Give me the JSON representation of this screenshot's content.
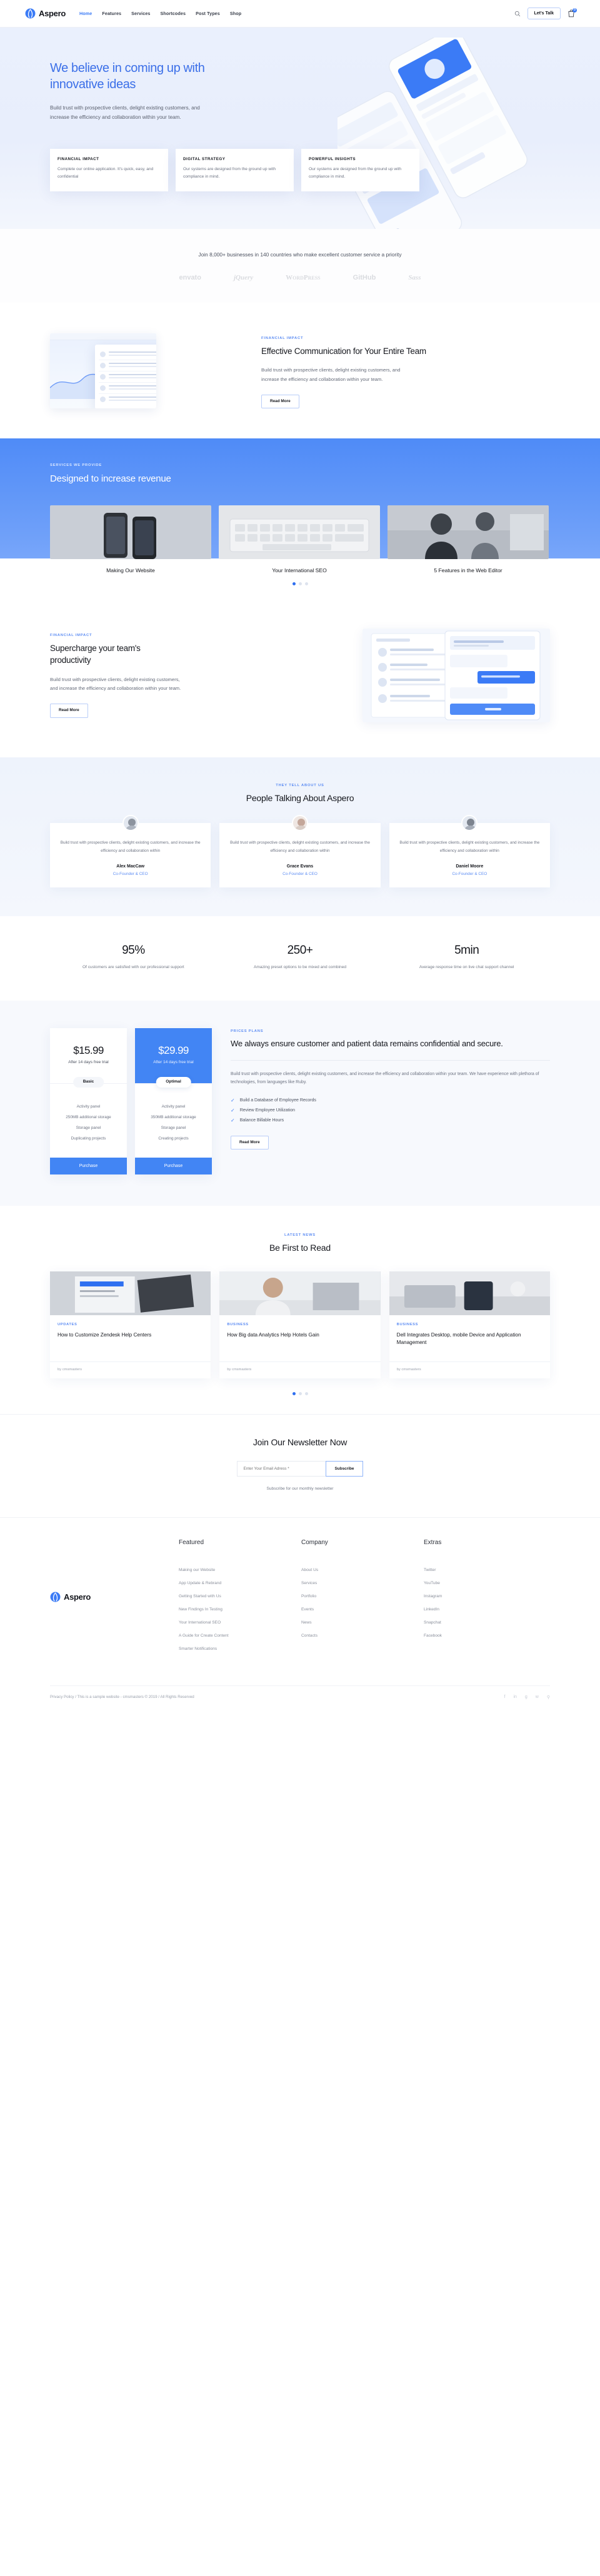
{
  "brand": {
    "name": "Aspero",
    "logo_icon": "aspero-logo-icon"
  },
  "header": {
    "nav": [
      {
        "label": "Home",
        "active": true
      },
      {
        "label": "Features",
        "active": false
      },
      {
        "label": "Services",
        "active": false
      },
      {
        "label": "Shortcodes",
        "active": false
      },
      {
        "label": "Post Types",
        "active": false
      },
      {
        "label": "Shop",
        "active": false
      }
    ],
    "search_icon": "search-icon",
    "cta_label": "Let's Talk",
    "cart_icon": "cart-icon",
    "cart_count": "0"
  },
  "hero": {
    "title": "We believe in coming up with innovative ideas",
    "subtitle": "Build trust with prospective clients, delight existing customers, and increase the efficiency and collaboration within your team.",
    "cards": [
      {
        "title": "FINANCIAL IMPACT",
        "text": "Complete our online application. It's quick, easy, and confidential"
      },
      {
        "title": "DIGITAL STRATEGY",
        "text": "Our systems are designed from the ground up with compliance in mind."
      },
      {
        "title": "POWERFUL INSIGHTS",
        "text": "Our systems are designed from the ground up with compliance in mind."
      }
    ]
  },
  "trust": {
    "line": "Join 8,000+ businesses in 140 countries who make excellent customer service a priority",
    "logos": [
      "envato",
      "jQuery",
      "WordPress",
      "GitHub",
      "Sass"
    ]
  },
  "feature": {
    "eyebrow": "FINANCIAL IMPACT",
    "title": "Effective Communication for Your Entire Team",
    "text": "Build trust with prospective clients, delight existing customers, and increase the efficiency and collaboration within your team.",
    "button": "Read More"
  },
  "services": {
    "eyebrow": "SERVICES WE PROVIDE",
    "title": "Designed to increase revenue",
    "cards": [
      {
        "caption": "Making Our Website"
      },
      {
        "caption": "Your International SEO"
      },
      {
        "caption": "5 Features in the Web Editor"
      }
    ],
    "dots": 3,
    "active_dot": 0
  },
  "supercharge": {
    "eyebrow": "FINANCIAL IMPACT",
    "title": "Supercharge your team's productivity",
    "text": "Build trust with prospective clients, delight existing customers, and increase the efficiency and collaboration within your team.",
    "button": "Read More"
  },
  "testimonials": {
    "eyebrow": "THEY TELL ABOUT US",
    "title": "People Talking About Aspero",
    "items": [
      {
        "quote": "Build trust with prospective clients, delight existing customers, and increase the efficiency and collaboration within",
        "name": "Alex MacCaw",
        "role": "Co-Founder & CEO"
      },
      {
        "quote": "Build trust with prospective clients, delight existing customers, and increase the efficiency and collaboration within",
        "name": "Grace Evans",
        "role": "Co-Founder & CEO"
      },
      {
        "quote": "Build trust with prospective clients, delight existing customers, and increase the efficiency and collaboration within",
        "name": "Daniel Moore",
        "role": "Co-Founder & CEO"
      }
    ]
  },
  "stats": [
    {
      "value": "95%",
      "text": "Of customers are satisfied with our professional support"
    },
    {
      "value": "250+",
      "text": "Amazing preset options to be mixed and combined"
    },
    {
      "value": "5min",
      "text": "Average response time on live chat support channel"
    }
  ],
  "pricing": {
    "plans": [
      {
        "price": "$15.99",
        "sub": "After 14 days free trial",
        "badge": "Basic",
        "features": [
          "Activity panel",
          "250MB additional storage",
          "Storage panel",
          "Duplicating projects"
        ],
        "button": "Purchase",
        "featured": false
      },
      {
        "price": "$29.99",
        "sub": "After 14 days free trial",
        "badge": "Optimal",
        "features": [
          "Activity panel",
          "350MB additional storage",
          "Storage panel",
          "Creating projects"
        ],
        "button": "Purchase",
        "featured": true
      }
    ],
    "eyebrow": "PRICES PLANS",
    "title": "We always ensure customer and patient data remains confidential and secure.",
    "text": "Build trust with prospective clients, delight existing customers, and increase the efficiency and collaboration within your team. We have experience with plethora of technologies, from languages like Ruby.",
    "checks": [
      "Build a Database of Employee Records",
      "Review Employee Utilization",
      "Balance Billable Hours"
    ],
    "button": "Read More"
  },
  "blog": {
    "eyebrow": "LATEST NEWS",
    "title": "Be First to Read",
    "posts": [
      {
        "category": "UPDATES",
        "title": "How to Customize Zendesk Help Centers",
        "meta": "by cmsmasters"
      },
      {
        "category": "BUSINESS",
        "title": "How Big data Analytics Help Hotels Gain",
        "meta": "by cmsmasters"
      },
      {
        "category": "BUSINESS",
        "title": "Dell Integrates Desktop, mobile Device and Application Management",
        "meta": "by cmsmasters"
      }
    ],
    "dots": 3,
    "active_dot": 0
  },
  "newsletter": {
    "title": "Join Our Newsletter Now",
    "placeholder": "Enter Your Email Adress *",
    "value": "",
    "button": "Subscribe",
    "note": "Subscribe for our monthly newsletter"
  },
  "footer": {
    "columns": [
      {
        "heading": "Featured",
        "links": [
          "Making our Website",
          "App Update & Rebrand",
          "Getting Started with Us",
          "New Findings In Testing",
          "Your International SEO",
          "A Guide for Create Content",
          "Smarter Notifications"
        ]
      },
      {
        "heading": "Company",
        "links": [
          "About Us",
          "Services",
          "Portfolio",
          "Events",
          "News",
          "Contacts"
        ]
      },
      {
        "heading": "Extras",
        "links": [
          "Twitter",
          "YouTube",
          "Instagram",
          "LinkedIn",
          "Snapchat",
          "Facebook"
        ]
      }
    ],
    "copyright": "Privacy Policy / This is a sample website - cmsmasters © 2019 / All Rights Reserved",
    "socials": [
      "facebook-icon",
      "linkedin-icon",
      "google-plus-icon",
      "twitter-icon",
      "search-icon"
    ]
  },
  "colors": {
    "accent": "#3b7bf6",
    "accent_dark": "#4285f4",
    "hero_text": "#3b6fe8",
    "muted": "#6d7382"
  }
}
